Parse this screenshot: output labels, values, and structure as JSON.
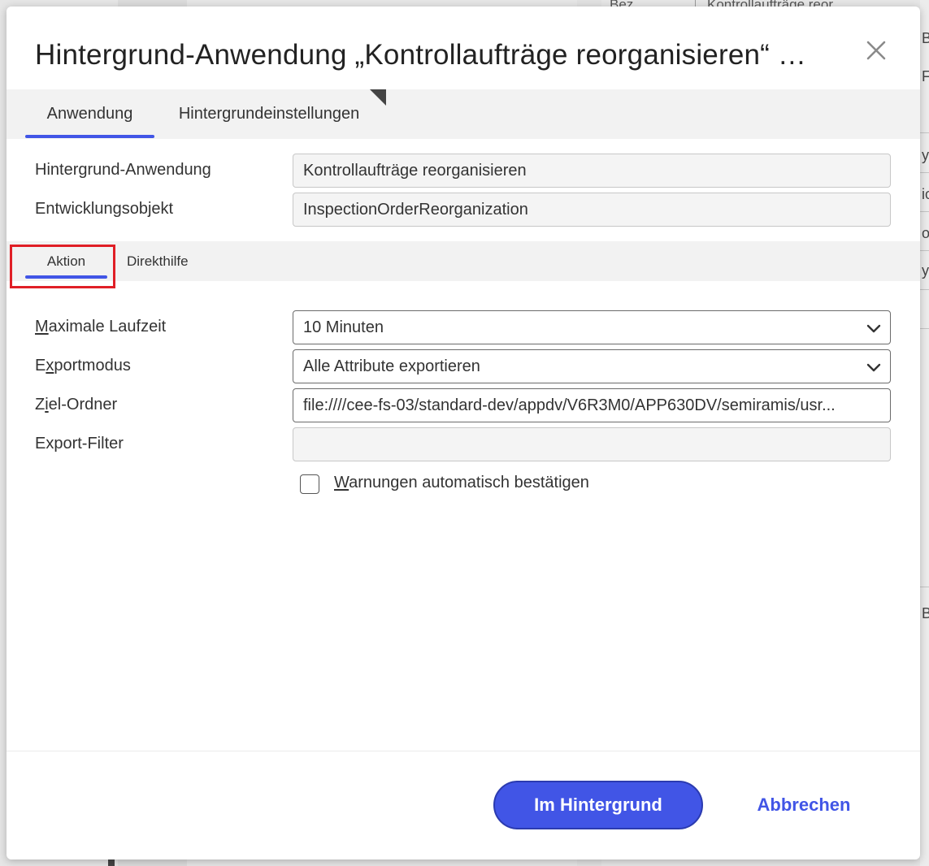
{
  "background": {
    "cells": [
      "Bez...",
      "Kontrollaufträge reor..."
    ],
    "right_edge": [
      "B",
      "F",
      "yN",
      "io",
      "ob",
      "yN",
      "Be"
    ]
  },
  "dialog": {
    "title": "Hintergrund-Anwendung „Kontrollaufträge reorganisieren“ …",
    "close_icon": "close-icon"
  },
  "main_tabs": [
    {
      "label": "Anwendung",
      "active": true
    },
    {
      "label": "Hintergrundeinstellungen",
      "active": false
    }
  ],
  "app_fields": {
    "app_label": "Hintergrund-Anwendung",
    "app_value": "Kontrollaufträge reorganisieren",
    "dev_label": "Entwicklungsobjekt",
    "dev_value": "InspectionOrderReorganization"
  },
  "sub_tabs": [
    {
      "label": "Aktion",
      "active": true
    },
    {
      "label": "Direkthilfe",
      "active": false
    }
  ],
  "action_form": {
    "runtime_label_mnemonic": "M",
    "runtime_label_rest": "aximale Laufzeit",
    "runtime_value": "10 Minuten",
    "export_label_pre": "E",
    "export_label_mnemonic": "x",
    "export_label_rest": "portmodus",
    "export_value": "Alle Attribute exportieren",
    "folder_label_pre": "Z",
    "folder_label_mnemonic": "i",
    "folder_label_rest": "el-Ordner",
    "folder_value": "file:////cee-fs-03/standard-dev/appdv/V6R3M0/APP630DV/semiramis/usr...",
    "filter_label": "Export-Filter",
    "filter_value": "",
    "warn_mnemonic": "W",
    "warn_rest": "arnungen automatisch bestätigen",
    "warn_checked": false
  },
  "footer": {
    "primary_label": "Im Hintergrund",
    "cancel_label": "Abbrechen"
  },
  "colors": {
    "accent": "#4155e6",
    "highlight": "#e01f26"
  }
}
